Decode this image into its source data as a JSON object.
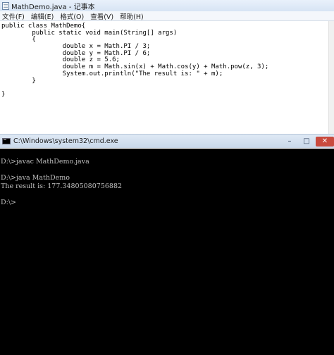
{
  "notepad": {
    "title": "MathDemo.java - 记事本",
    "menu": [
      "文件(F)",
      "编辑(E)",
      "格式(O)",
      "查看(V)",
      "帮助(H)"
    ],
    "code_lines": [
      "public class MathDemo{",
      "        public static void main(String[] args)",
      "        {",
      "                double x = Math.PI / 3;",
      "                double y = Math.PI / 6;",
      "                double z = 5.6;",
      "                double m = Math.sin(x) + Math.cos(y) + Math.pow(z, 3);",
      "                System.out.println(\"The result is: \" + m);",
      "        }",
      "",
      "}"
    ]
  },
  "cmd": {
    "title": "C:\\Windows\\system32\\cmd.exe",
    "controls": {
      "minimize": "–",
      "maximize": "□",
      "close": "✕"
    },
    "lines": [
      "D:\\>javac MathDemo.java",
      "",
      "D:\\>java MathDemo",
      "The result is: 177.34805080756882",
      "",
      "D:\\>"
    ]
  }
}
